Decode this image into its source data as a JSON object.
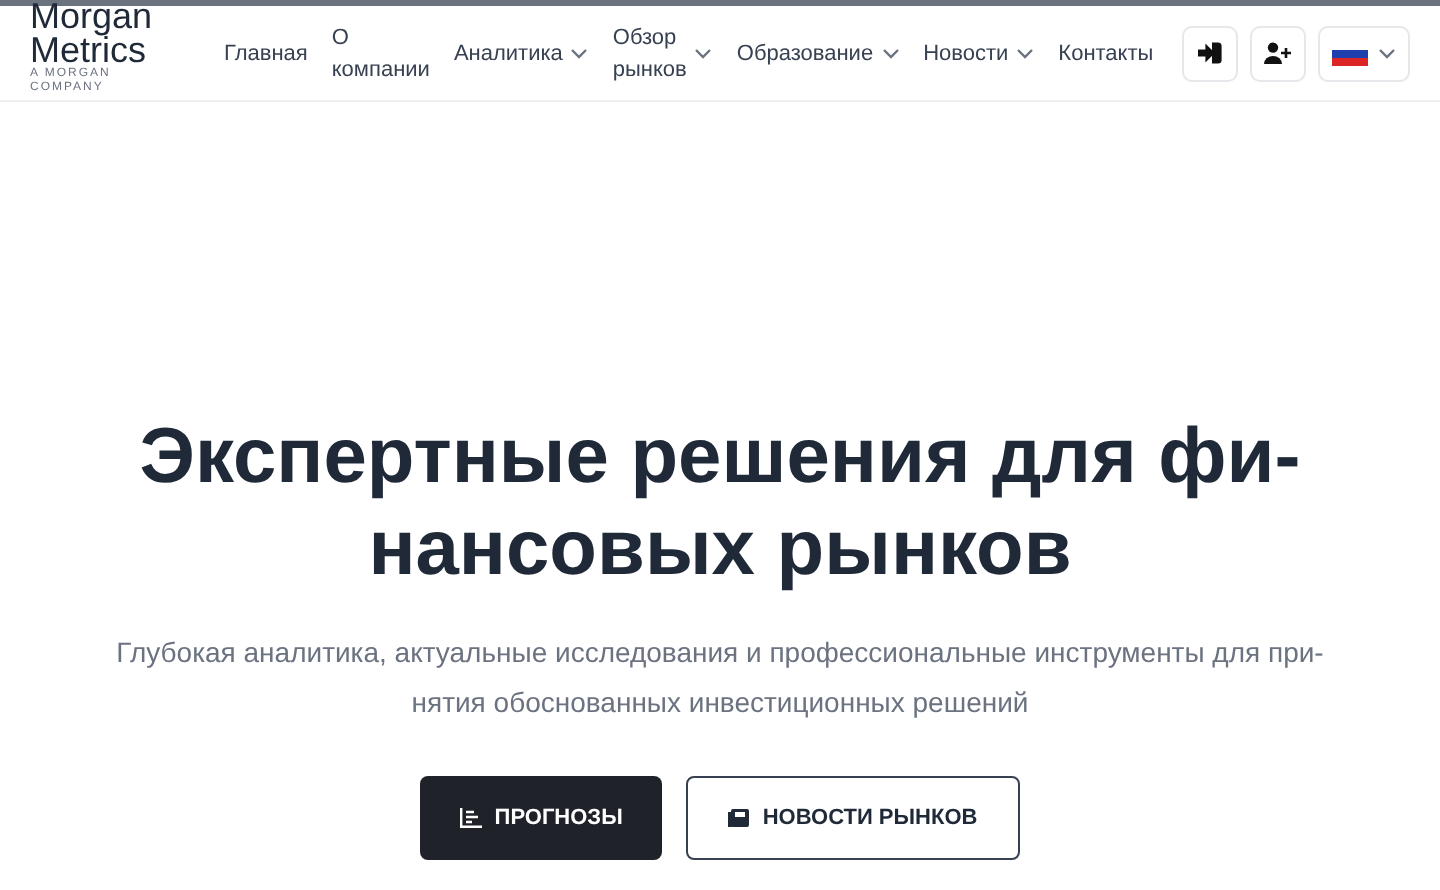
{
  "logo": {
    "name_lines": [
      "Morgan",
      "Metrics"
    ],
    "tagline_lines": [
      "A MORGAN",
      "COMPANY"
    ]
  },
  "nav": [
    {
      "label_lines": [
        "Главная"
      ],
      "dropdown": false
    },
    {
      "label_lines": [
        "О",
        "компании"
      ],
      "dropdown": false
    },
    {
      "label_lines": [
        "Аналитика"
      ],
      "dropdown": true
    },
    {
      "label_lines": [
        "Обзор",
        "рынков"
      ],
      "dropdown": true
    },
    {
      "label_lines": [
        "Образование"
      ],
      "dropdown": true
    },
    {
      "label_lines": [
        "Новости"
      ],
      "dropdown": true
    },
    {
      "label_lines": [
        "Контакты"
      ],
      "dropdown": false
    }
  ],
  "hero": {
    "title_lines": [
      "Экспертные решения для фи-",
      "нансовых рынков"
    ],
    "subtitle_lines": [
      "Глубокая аналитика, актуальные исследования и профессиональные инструменты для при-",
      "нятия обоснованных инвестиционных решений"
    ],
    "buttons": [
      {
        "label": "ПРОГНОЗЫ",
        "kind": "primary"
      },
      {
        "label": "НОВОСТИ РЫНКОВ",
        "kind": "outline"
      }
    ]
  }
}
